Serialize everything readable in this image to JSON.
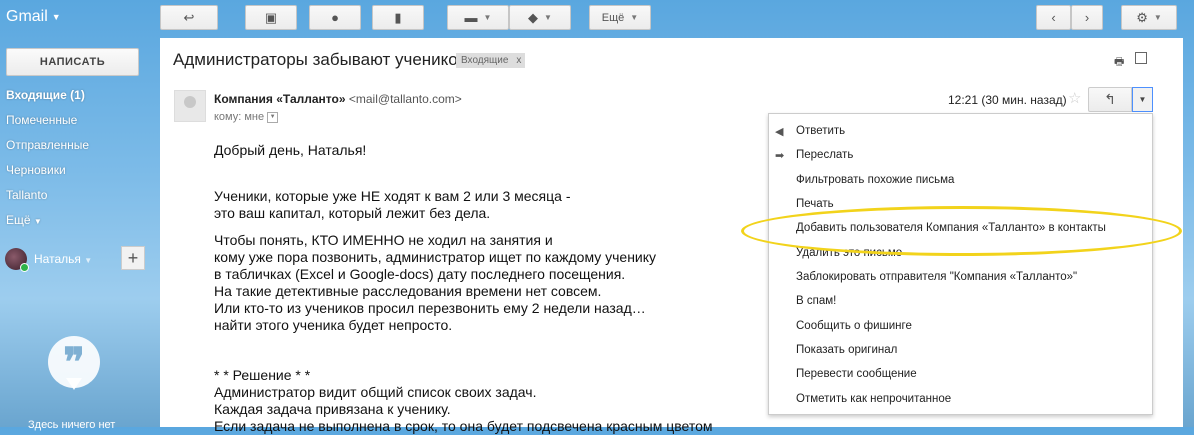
{
  "app": {
    "title": "Gmail"
  },
  "toolbar": {
    "more_label": "Ещё",
    "icons": [
      "back-arrow-icon",
      "archive-icon",
      "spam-icon",
      "trash-icon",
      "folder-icon",
      "tag-icon",
      "chevron-left-icon",
      "chevron-right-icon",
      "gear-icon"
    ]
  },
  "sidebar": {
    "compose_label": "НАПИСАТЬ",
    "items": [
      {
        "label": "Входящие (1)"
      },
      {
        "label": "Помеченные"
      },
      {
        "label": "Отправленные"
      },
      {
        "label": "Черновики"
      },
      {
        "label": "Tallanto"
      },
      {
        "label": "Ещё"
      }
    ],
    "user_name": "Наталья",
    "hangouts_text": "Здесь ничего нет"
  },
  "message": {
    "subject": "Администраторы забывают учеников",
    "label": "Входящие",
    "label_close": "x",
    "sender_name": "Компания «Талланто»",
    "sender_email": "<mail@tallanto.com>",
    "to_line": "кому: мне",
    "time": "12:21 (30 мин. назад)",
    "body": [
      "Добрый день, Наталья!",
      "",
      "Ученики, которые уже НЕ ходят к вам 2 или 3 месяца -",
      "это ваш капитал, который лежит без дела.",
      "Чтобы понять, КТО ИМЕННО не ходил на занятия и",
      "кому уже пора позвонить, администратор ищет по каждому ученику",
      "в табличках (Excel и Google-docs) дату последнего посещения.",
      "На такие детективные расследования времени нет совсем.",
      "Или кто-то из учеников просил перезвонить ему 2 недели назад…",
      "найти этого ученика будет непросто.",
      "* * Решение * *",
      "Администратор видит общий список своих задач.",
      "Каждая задача привязана к ученику.",
      "Если задача не выполнена в срок, то она будет подсвечена красным цветом"
    ]
  },
  "menu": {
    "items": [
      {
        "label": "Ответить",
        "icon": "reply-icon"
      },
      {
        "label": "Переслать",
        "icon": "forward-icon"
      },
      {
        "label": "Фильтровать похожие письма"
      },
      {
        "label": "Печать"
      },
      {
        "label": "Добавить пользователя Компания «Талланто» в контакты"
      },
      {
        "label": "Удалить это письмо"
      },
      {
        "label": "Заблокировать отправителя \"Компания «Талланто»\""
      },
      {
        "label": "В спам!"
      },
      {
        "label": "Сообщить о фишинге"
      },
      {
        "label": "Показать оригинал"
      },
      {
        "label": "Перевести сообщение"
      },
      {
        "label": "Отметить как непрочитанное"
      }
    ]
  },
  "colors": {
    "accent": "#4d90fe",
    "highlight": "#f2d31b",
    "online": "#2fb34a"
  }
}
